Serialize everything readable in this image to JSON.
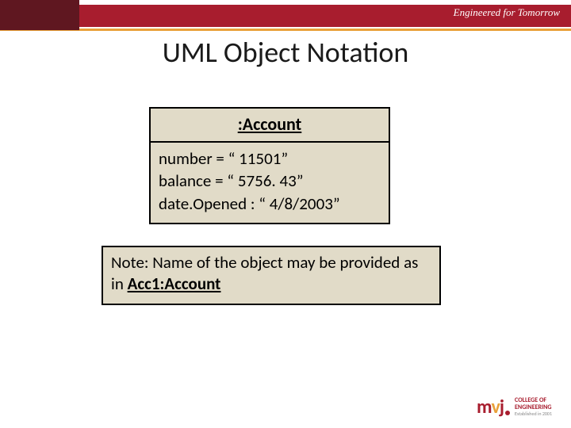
{
  "header": {
    "tagline": "Engineered for Tomorrow"
  },
  "title": "UML Object Notation",
  "uml": {
    "class_label": ":Account",
    "attr1": "number = “ 11501”",
    "attr2": "balance = “ 5756. 43”",
    "attr3": "date.Opened : “ 4/8/2003”"
  },
  "note": {
    "prefix": "Note: Name of the object may be provided as in ",
    "emph": "Acc1:Account"
  },
  "logo": {
    "m": "m",
    "v": "v",
    "j": "j",
    "line1": "COLLEGE OF",
    "line2": "ENGINEERING",
    "sub": "Established in 2001"
  }
}
